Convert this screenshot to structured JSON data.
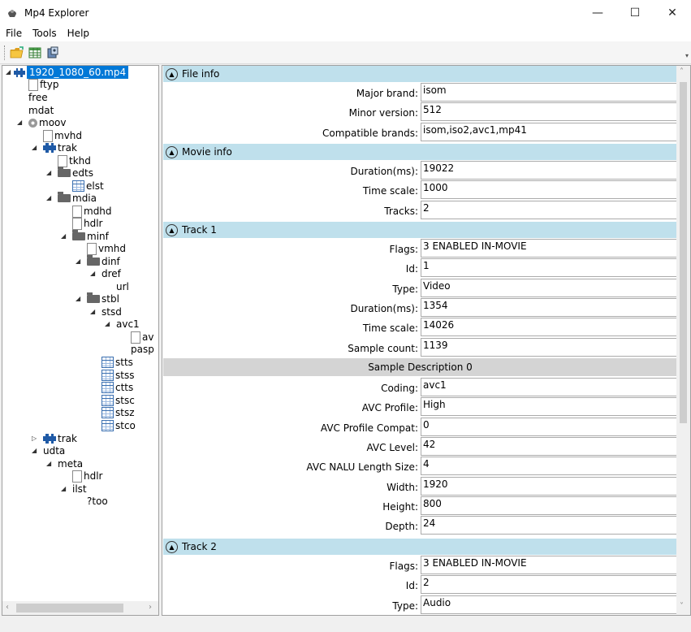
{
  "window": {
    "title": "Mp4 Explorer",
    "minimize": "—",
    "maximize": "☐",
    "close": "✕"
  },
  "menu": [
    "File",
    "Tools",
    "Help"
  ],
  "toolbar": {
    "buttons": [
      "open-folder-icon",
      "grid-icon",
      "export-icon"
    ],
    "overflow": "▾"
  },
  "tree": {
    "root": "1920_1080_60.mp4",
    "nodes": [
      {
        "label": "ftyp",
        "icon": "file"
      },
      {
        "label": "free",
        "icon": "none"
      },
      {
        "label": "mdat",
        "icon": "none"
      },
      {
        "label": "moov",
        "icon": "disc"
      },
      {
        "label": "mvhd",
        "icon": "file"
      },
      {
        "label": "trak",
        "icon": "film"
      },
      {
        "label": "tkhd",
        "icon": "file"
      },
      {
        "label": "edts",
        "icon": "folder"
      },
      {
        "label": "elst",
        "icon": "table"
      },
      {
        "label": "mdia",
        "icon": "folder"
      },
      {
        "label": "mdhd",
        "icon": "file"
      },
      {
        "label": "hdlr",
        "icon": "file"
      },
      {
        "label": "minf",
        "icon": "folder"
      },
      {
        "label": "vmhd",
        "icon": "file"
      },
      {
        "label": "dinf",
        "icon": "folder"
      },
      {
        "label": "dref",
        "icon": "none"
      },
      {
        "label": "url",
        "icon": "none"
      },
      {
        "label": "stbl",
        "icon": "folder"
      },
      {
        "label": "stsd",
        "icon": "none"
      },
      {
        "label": "avc1",
        "icon": "none"
      },
      {
        "label": "av",
        "icon": "file"
      },
      {
        "label": "pasp",
        "icon": "none"
      },
      {
        "label": "stts",
        "icon": "table"
      },
      {
        "label": "stss",
        "icon": "table"
      },
      {
        "label": "ctts",
        "icon": "table"
      },
      {
        "label": "stsc",
        "icon": "table"
      },
      {
        "label": "stsz",
        "icon": "table"
      },
      {
        "label": "stco",
        "icon": "table"
      },
      {
        "label": "trak",
        "icon": "film"
      },
      {
        "label": "udta",
        "icon": "none"
      },
      {
        "label": "meta",
        "icon": "none"
      },
      {
        "label": "hdlr",
        "icon": "file"
      },
      {
        "label": "ilst",
        "icon": "none"
      },
      {
        "label": "?too",
        "icon": "none"
      }
    ]
  },
  "sections": {
    "file_info": {
      "title": "File info",
      "fields": [
        {
          "label": "Major brand:",
          "value": "isom"
        },
        {
          "label": "Minor version:",
          "value": "512"
        },
        {
          "label": "Compatible brands:",
          "value": "isom,iso2,avc1,mp41"
        }
      ]
    },
    "movie_info": {
      "title": "Movie info",
      "fields": [
        {
          "label": "Duration(ms):",
          "value": "19022"
        },
        {
          "label": "Time scale:",
          "value": "1000"
        },
        {
          "label": "Tracks:",
          "value": "2"
        }
      ]
    },
    "track1": {
      "title": "Track 1",
      "fields": [
        {
          "label": "Flags:",
          "value": "3 ENABLED IN-MOVIE"
        },
        {
          "label": "Id:",
          "value": "1"
        },
        {
          "label": "Type:",
          "value": "Video"
        },
        {
          "label": "Duration(ms):",
          "value": "1354"
        },
        {
          "label": "Time scale:",
          "value": "14026"
        },
        {
          "label": "Sample count:",
          "value": "1139"
        }
      ],
      "sample_description": {
        "title": "Sample Description 0",
        "fields": [
          {
            "label": "Coding:",
            "value": "avc1"
          },
          {
            "label": "AVC Profile:",
            "value": "High"
          },
          {
            "label": "AVC Profile Compat:",
            "value": "0"
          },
          {
            "label": "AVC Level:",
            "value": "42"
          },
          {
            "label": "AVC NALU Length Size:",
            "value": "4"
          },
          {
            "label": "Width:",
            "value": "1920"
          },
          {
            "label": "Height:",
            "value": "800"
          },
          {
            "label": "Depth:",
            "value": "24"
          }
        ]
      }
    },
    "track2": {
      "title": "Track 2",
      "fields": [
        {
          "label": "Flags:",
          "value": "3 ENABLED IN-MOVIE"
        },
        {
          "label": "Id:",
          "value": "2"
        },
        {
          "label": "Type:",
          "value": "Audio"
        }
      ]
    }
  }
}
